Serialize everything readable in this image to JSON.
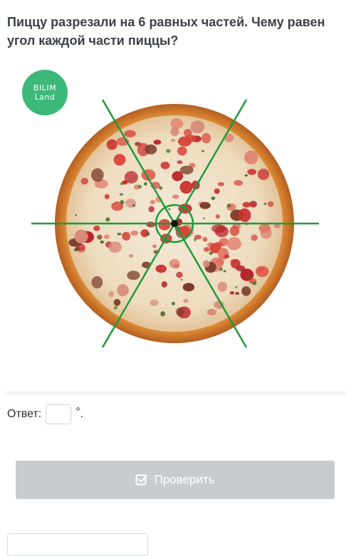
{
  "question": {
    "text": "Пиццу разрезали на 6 равных частей. Чему равен угол каждой части пиццы?"
  },
  "logo": {
    "line1": "BILIM",
    "line2": "Land",
    "color": "#3cb879"
  },
  "figure": {
    "slices": 6,
    "cut_line_color": "#1f9a3a",
    "icon": "pizza-image"
  },
  "answer": {
    "label": "Ответ:",
    "value": "",
    "unit": "°",
    "terminator": "."
  },
  "check_button": {
    "label": "Проверить",
    "icon": "checkbox-icon",
    "color": "#c9ccce"
  }
}
